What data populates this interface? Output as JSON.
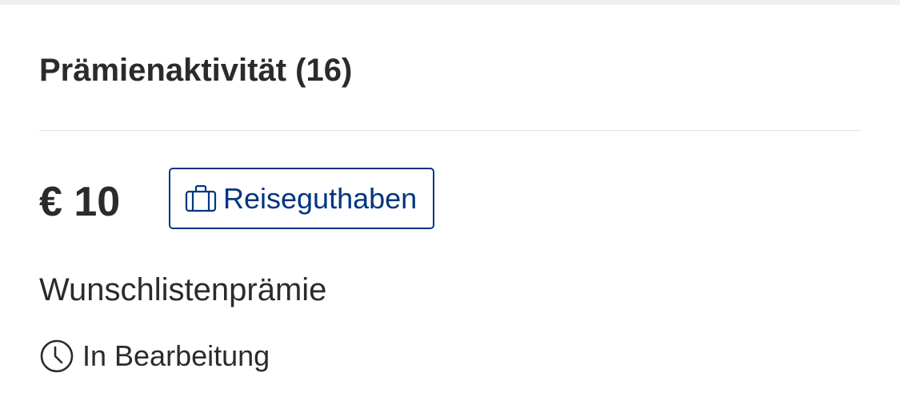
{
  "section": {
    "title": "Prämienaktivität (16)"
  },
  "reward": {
    "amount": "€ 10",
    "type_badge": {
      "label": "Reiseguthaben",
      "icon": "suitcase-icon"
    },
    "name": "Wunschlistenprämie",
    "status": {
      "label": "In Bearbeitung",
      "icon": "clock-icon"
    }
  },
  "colors": {
    "accent": "#003580",
    "text": "#2b2b2b",
    "divider": "#e2e2e2",
    "top_strip": "#efefef"
  }
}
